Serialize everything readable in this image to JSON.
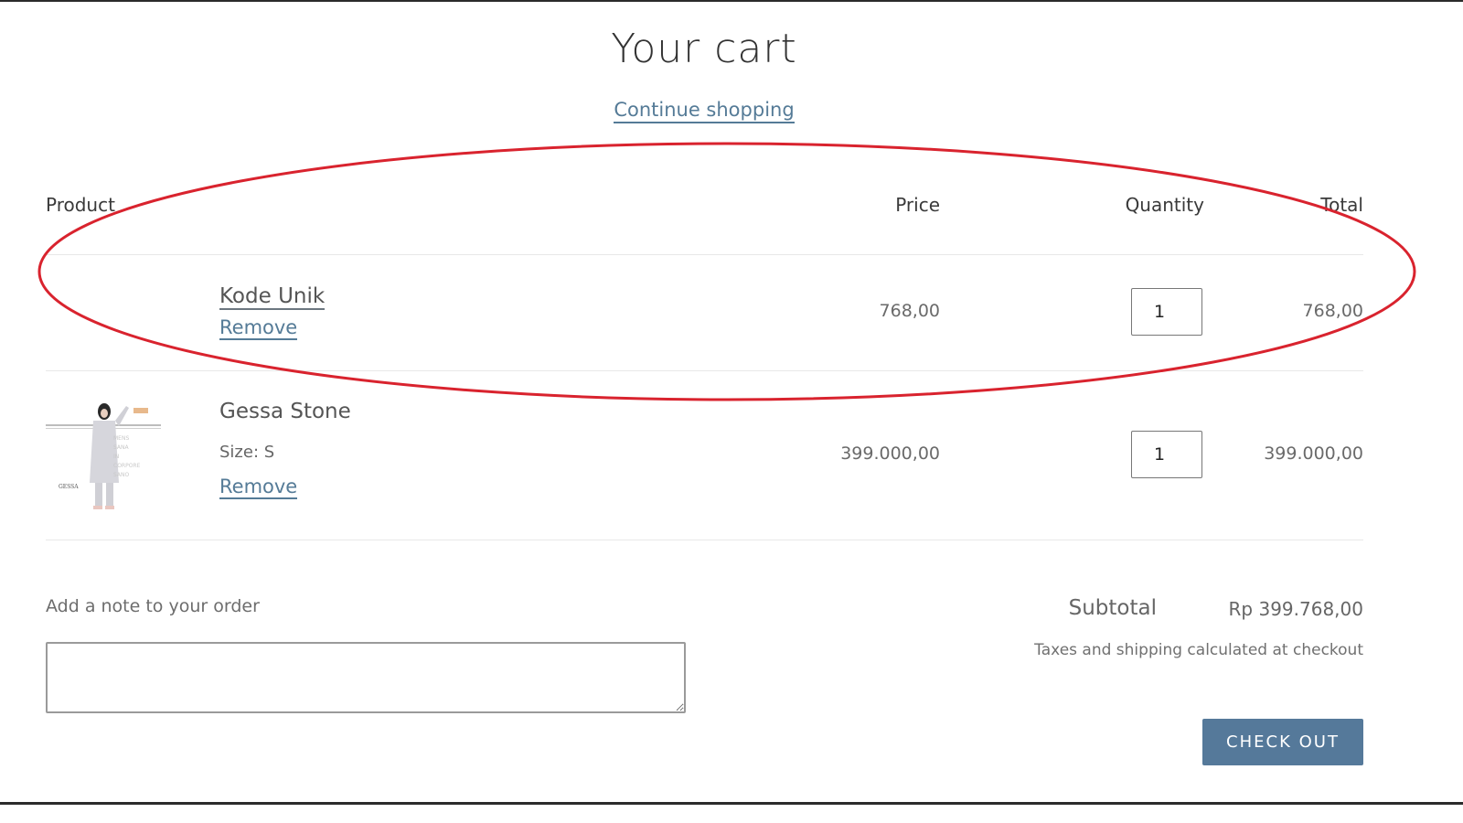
{
  "header": {
    "title": "Your cart",
    "continue_link": "Continue shopping"
  },
  "table": {
    "columns": [
      "Product",
      "Price",
      "Quantity",
      "Total"
    ],
    "rows": [
      {
        "name": "Kode Unik",
        "variant": null,
        "remove_label": "Remove",
        "price": "768,00",
        "quantity": "1",
        "total": "768,00",
        "has_image": false
      },
      {
        "name": "Gessa Stone",
        "variant": "Size: S",
        "remove_label": "Remove",
        "price": "399.000,00",
        "quantity": "1",
        "total": "399.000,00",
        "has_image": true,
        "image_text": "GESSA"
      }
    ]
  },
  "note": {
    "label": "Add a note to your order",
    "value": ""
  },
  "summary": {
    "subtotal_label": "Subtotal",
    "subtotal_value": "Rp 399.768,00",
    "tax_note": "Taxes and shipping calculated at checkout",
    "checkout_label": "CHECK OUT"
  },
  "colors": {
    "link": "#557b97",
    "checkout_button": "#55799a",
    "annotation": "#d9232e"
  },
  "annotation": {
    "shape": "ellipse",
    "highlights": "Kode Unik row"
  }
}
